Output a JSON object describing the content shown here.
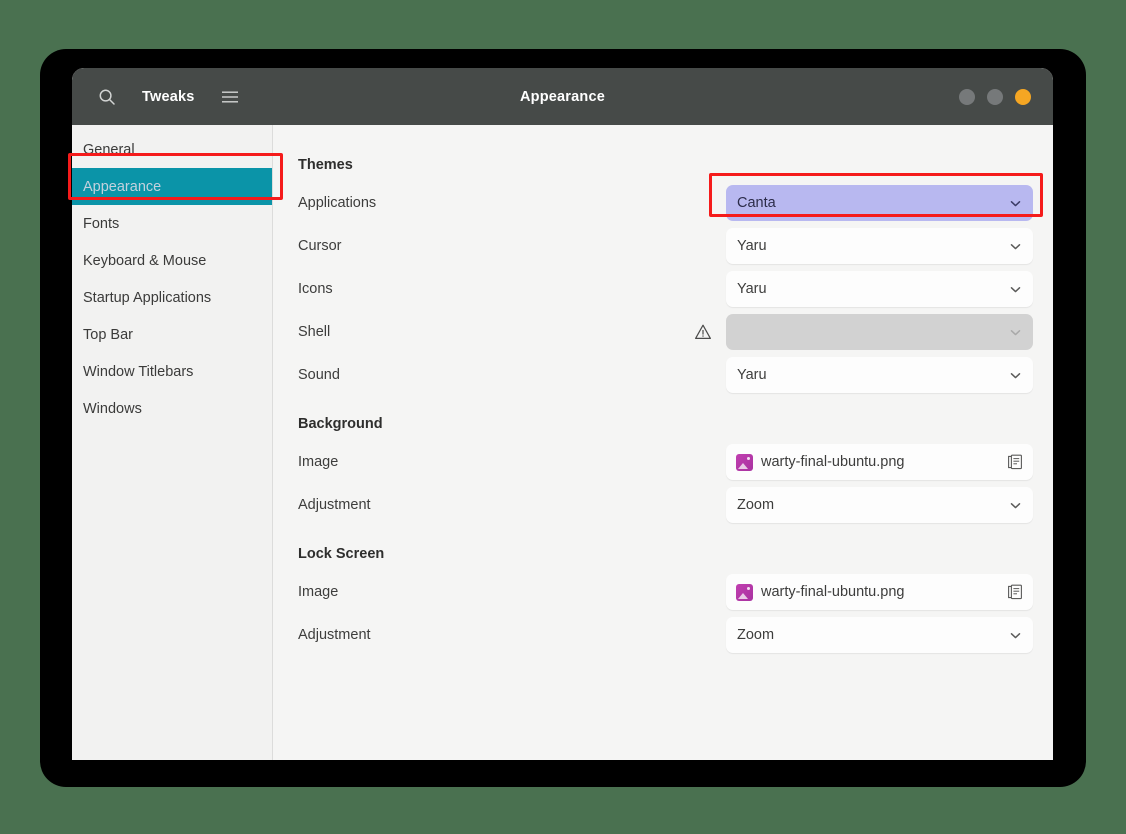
{
  "window": {
    "app_title": "Tweaks",
    "page_title": "Appearance",
    "search_icon": "search-icon",
    "menu_icon": "hamburger-menu-icon",
    "controls": [
      {
        "name": "minimize-button",
        "color": "#76797a"
      },
      {
        "name": "maximize-button",
        "color": "#76797a"
      },
      {
        "name": "close-button",
        "color": "#f5a623"
      }
    ]
  },
  "sidebar": {
    "items": [
      {
        "label": "General",
        "selected": false
      },
      {
        "label": "Appearance",
        "selected": true
      },
      {
        "label": "Fonts",
        "selected": false
      },
      {
        "label": "Keyboard & Mouse",
        "selected": false
      },
      {
        "label": "Startup Applications",
        "selected": false
      },
      {
        "label": "Top Bar",
        "selected": false
      },
      {
        "label": "Window Titlebars",
        "selected": false
      },
      {
        "label": "Windows",
        "selected": false
      }
    ]
  },
  "content": {
    "sections": [
      {
        "title": "Themes",
        "rows": [
          {
            "label": "Applications",
            "type": "combo",
            "value": "Canta",
            "highlighted": true,
            "disabled": false,
            "warning": false
          },
          {
            "label": "Cursor",
            "type": "combo",
            "value": "Yaru",
            "highlighted": false,
            "disabled": false,
            "warning": false
          },
          {
            "label": "Icons",
            "type": "combo",
            "value": "Yaru",
            "highlighted": false,
            "disabled": false,
            "warning": false
          },
          {
            "label": "Shell",
            "type": "combo",
            "value": "",
            "highlighted": false,
            "disabled": true,
            "warning": true
          },
          {
            "label": "Sound",
            "type": "combo",
            "value": "Yaru",
            "highlighted": false,
            "disabled": false,
            "warning": false
          }
        ]
      },
      {
        "title": "Background",
        "rows": [
          {
            "label": "Image",
            "type": "file",
            "value": "warty-final-ubuntu.png",
            "highlighted": false,
            "disabled": false,
            "warning": false
          },
          {
            "label": "Adjustment",
            "type": "combo",
            "value": "Zoom",
            "highlighted": false,
            "disabled": false,
            "warning": false
          }
        ]
      },
      {
        "title": "Lock Screen",
        "rows": [
          {
            "label": "Image",
            "type": "file",
            "value": "warty-final-ubuntu.png",
            "highlighted": false,
            "disabled": false,
            "warning": false
          },
          {
            "label": "Adjustment",
            "type": "combo",
            "value": "Zoom",
            "highlighted": false,
            "disabled": false,
            "warning": false
          }
        ]
      }
    ]
  },
  "annotations": {
    "color": "#f51b1b",
    "targets": [
      "sidebar-item-appearance",
      "applications-theme-combo"
    ]
  },
  "colors": {
    "desktop_background": "#4a7150",
    "headerbar": "#464a48",
    "sidebar_selection": "#0b94a8",
    "combo_highlight": "#b8b8f0",
    "content_background": "#f5f5f4"
  }
}
